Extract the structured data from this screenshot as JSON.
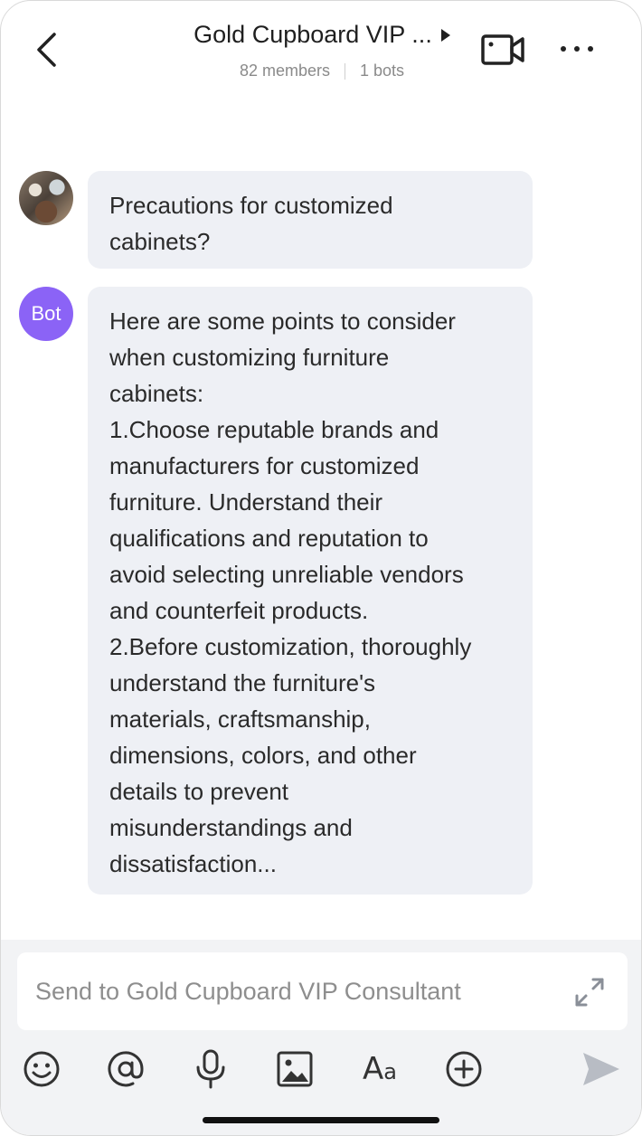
{
  "header": {
    "title": "Gold Cupboard VIP ...",
    "members": "82 members",
    "bots": "1 bots"
  },
  "messages": [
    {
      "sender": "user",
      "text": "Precautions for customized\ncabinets?"
    },
    {
      "sender": "bot",
      "avatar_label": "Bot",
      "text": "Here are some points to consider\nwhen customizing furniture\ncabinets:\n1.Choose reputable brands and\nmanufacturers for customized\nfurniture. Understand their\nqualifications and reputation to\navoid selecting unreliable vendors\nand counterfeit products.\n2.Before customization, thoroughly\nunderstand the furniture's\nmaterials, craftsmanship,\ndimensions, colors, and other\ndetails to prevent\nmisunderstandings and\ndissatisfaction..."
    }
  ],
  "composer": {
    "placeholder": "Send to Gold Cupboard VIP Consultant",
    "value": "",
    "aa_label_big": "A",
    "aa_label_small": "a"
  },
  "icons": {
    "back": "chevron-left-icon",
    "video": "video-camera-icon",
    "more": "more-horizontal-icon",
    "expand": "expand-arrows-icon",
    "emoji": "smiley-icon",
    "mention": "at-sign-icon",
    "voice": "microphone-icon",
    "image": "image-icon",
    "font": "text-format-icon",
    "add": "plus-circle-icon",
    "send": "send-icon"
  },
  "colors": {
    "bot_avatar": "#8b63f6",
    "bubble_bg": "#eef0f5",
    "composer_bg": "#f2f3f5",
    "send_disabled": "#b8bcc4"
  }
}
